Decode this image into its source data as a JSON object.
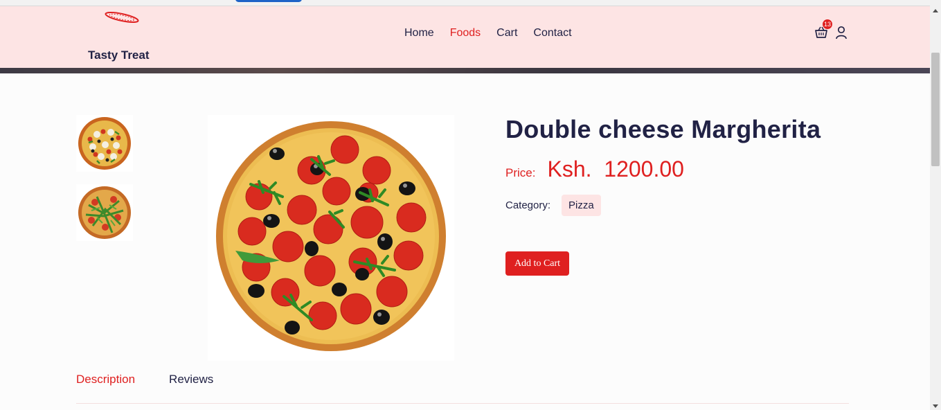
{
  "header": {
    "brand": "Tasty Treat",
    "nav": [
      {
        "label": "Home",
        "active": false
      },
      {
        "label": "Foods",
        "active": true
      },
      {
        "label": "Cart",
        "active": false
      },
      {
        "label": "Contact",
        "active": false
      }
    ],
    "cart_count": "13",
    "icons": [
      "logo-icon",
      "shopping-basket-icon",
      "user-icon"
    ]
  },
  "product": {
    "title": "Double cheese Margherita",
    "price_label": "Price:",
    "price_value": "Ksh.  1200.00",
    "category_label": "Category:",
    "category": "Pizza",
    "add_to_cart_label": "Add to Cart"
  },
  "tabs": [
    {
      "label": "Description",
      "active": true
    },
    {
      "label": "Reviews",
      "active": false
    }
  ],
  "colors": {
    "accent": "#df2020",
    "header_bg": "#fde4e4",
    "text": "#212245"
  }
}
